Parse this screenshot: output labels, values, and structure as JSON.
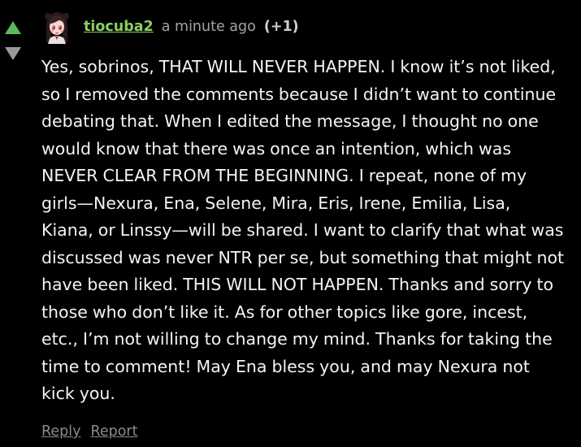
{
  "comment": {
    "username": "tiocuba2",
    "timestamp": "a minute ago",
    "score": "(+1)",
    "body": "Yes, sobrinos, THAT WILL NEVER HAPPEN. I know it’s not liked, so I removed the comments because I didn’t want to continue debating that. When I edited the message, I thought no one would know that there was once an intention, which was NEVER CLEAR FROM THE BEGINNING. I repeat, none of my girls—Nexura, Ena, Selene, Mira, Eris, Irene, Emilia, Lisa, Kiana, or Linssy—will be shared. I want to clarify that what was discussed was never NTR per se, but something that might not have been liked. THIS WILL NOT HAPPEN. Thanks and sorry to those who don’t like it. As for other topics like gore, incest, etc., I’m not willing to change my mind. Thanks for taking the time to comment! May Ena bless you, and may Nexura not kick you."
  },
  "actions": {
    "reply_label": "Reply",
    "report_label": "Report"
  },
  "icons": {
    "upvote": "triangle-up-icon",
    "downvote": "triangle-down-icon",
    "avatar": "anime-girl-avatar"
  },
  "colors": {
    "background": "#000000",
    "upvote_active": "#5cb85c",
    "downvote": "#9a9a9a",
    "username": "#8ccf62",
    "text": "#f4f4f4",
    "muted": "#8a8a8a"
  }
}
